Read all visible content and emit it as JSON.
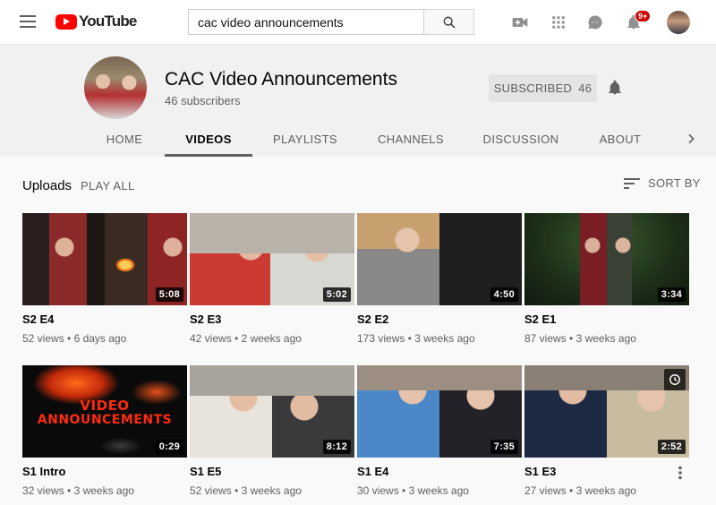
{
  "masthead": {
    "logo_text": "YouTube",
    "search_value": "cac video announcements",
    "notification_badge": "9+"
  },
  "channel": {
    "title": "CAC Video Announcements",
    "subscribers": "46 subscribers",
    "subscribed_label": "SUBSCRIBED",
    "subscribed_count": "46"
  },
  "tabs": [
    "HOME",
    "VIDEOS",
    "PLAYLISTS",
    "CHANNELS",
    "DISCUSSION",
    "ABOUT"
  ],
  "active_tab": "VIDEOS",
  "shelf": {
    "title": "Uploads",
    "play_all": "PLAY ALL",
    "sort_by": "SORT BY"
  },
  "videos": [
    {
      "title": "S2 E4",
      "duration": "5:08",
      "views": "52 views",
      "age": "6 days ago"
    },
    {
      "title": "S2 E3",
      "duration": "5:02",
      "views": "42 views",
      "age": "2 weeks ago"
    },
    {
      "title": "S2 E2",
      "duration": "4:50",
      "views": "173 views",
      "age": "3 weeks ago"
    },
    {
      "title": "S2 E1",
      "duration": "3:34",
      "views": "87 views",
      "age": "3 weeks ago"
    },
    {
      "title": "S1 Intro",
      "duration": "0:29",
      "views": "32 views",
      "age": "3 weeks ago",
      "overlay_line1": "VIDEO",
      "overlay_line2": "ANNOUNCEMENTS"
    },
    {
      "title": "S1 E5",
      "duration": "8:12",
      "views": "52 views",
      "age": "3 weeks ago"
    },
    {
      "title": "S1 E4",
      "duration": "7:35",
      "views": "30 views",
      "age": "3 weeks ago"
    },
    {
      "title": "S1 E3",
      "duration": "2:52",
      "views": "27 views",
      "age": "3 weeks ago"
    }
  ],
  "colors": {
    "brand_red": "#ff0000",
    "badge_red": "#cc0000",
    "header_bg": "#f1f1f1",
    "page_bg": "#f9f9f9"
  },
  "icons": [
    "menu-icon",
    "search-icon",
    "video-camera-icon",
    "apps-grid-icon",
    "messages-icon",
    "bell-icon",
    "chevron-right-icon",
    "sort-icon",
    "more-vert-icon",
    "watch-later-icon"
  ]
}
